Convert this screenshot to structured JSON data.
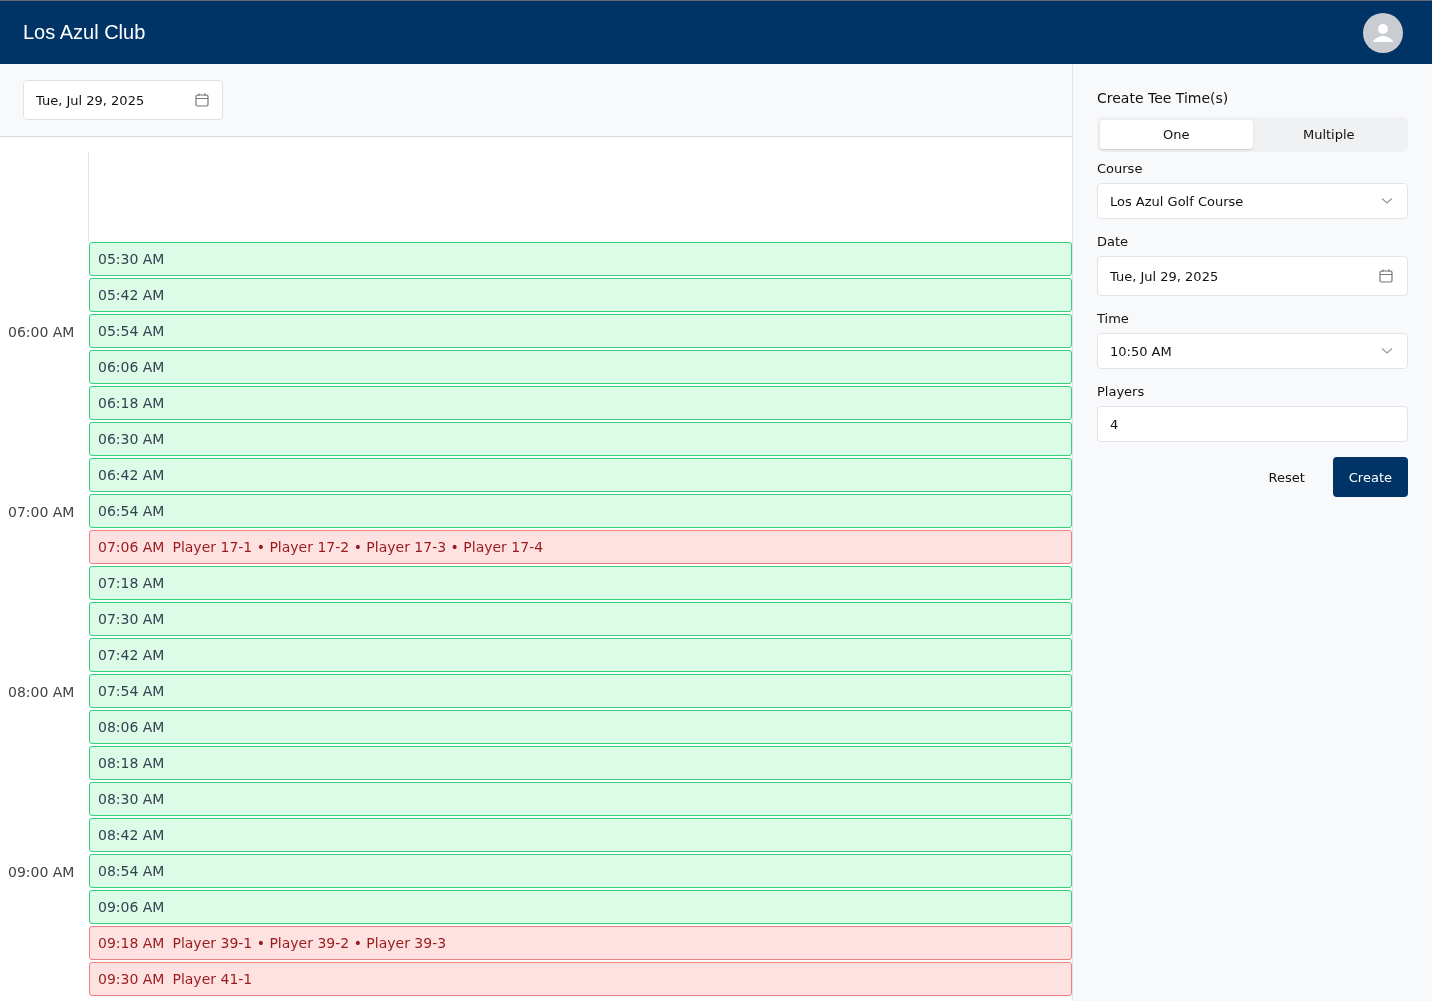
{
  "header": {
    "title": "Los Azul Club"
  },
  "toolbar": {
    "date": "Tue, Jul 29, 2025"
  },
  "slots": [
    {
      "time": "05:30 AM",
      "booked": false
    },
    {
      "time": "05:42 AM",
      "booked": false
    },
    {
      "time": "05:54 AM",
      "booked": false,
      "hour_label": "06:00 AM"
    },
    {
      "time": "06:06 AM",
      "booked": false
    },
    {
      "time": "06:18 AM",
      "booked": false
    },
    {
      "time": "06:30 AM",
      "booked": false
    },
    {
      "time": "06:42 AM",
      "booked": false
    },
    {
      "time": "06:54 AM",
      "booked": false,
      "hour_label": "07:00 AM"
    },
    {
      "time": "07:06 AM",
      "booked": true,
      "players": "Player 17-1 • Player 17-2 • Player 17-3 • Player 17-4"
    },
    {
      "time": "07:18 AM",
      "booked": false
    },
    {
      "time": "07:30 AM",
      "booked": false
    },
    {
      "time": "07:42 AM",
      "booked": false
    },
    {
      "time": "07:54 AM",
      "booked": false,
      "hour_label": "08:00 AM"
    },
    {
      "time": "08:06 AM",
      "booked": false
    },
    {
      "time": "08:18 AM",
      "booked": false
    },
    {
      "time": "08:30 AM",
      "booked": false
    },
    {
      "time": "08:42 AM",
      "booked": false
    },
    {
      "time": "08:54 AM",
      "booked": false,
      "hour_label": "09:00 AM"
    },
    {
      "time": "09:06 AM",
      "booked": false
    },
    {
      "time": "09:18 AM",
      "booked": true,
      "players": "Player 39-1 • Player 39-2 • Player 39-3"
    },
    {
      "time": "09:30 AM",
      "booked": true,
      "players": "Player 41-1"
    }
  ],
  "form": {
    "title": "Create Tee Time(s)",
    "modes": [
      {
        "label": "One",
        "selected": true
      },
      {
        "label": "Multiple",
        "selected": false
      }
    ],
    "fields": [
      {
        "label": "Course",
        "value": "Los Azul Golf Course",
        "kind": "select"
      },
      {
        "label": "Date",
        "value": "Tue, Jul 29, 2025",
        "kind": "date"
      },
      {
        "label": "Time",
        "value": "10:50 AM",
        "kind": "select"
      },
      {
        "label": "Players",
        "value": "4",
        "kind": "text"
      }
    ],
    "buttons": [
      {
        "label": "Reset",
        "kind": "secondary"
      },
      {
        "label": "Create",
        "kind": "primary"
      }
    ]
  }
}
